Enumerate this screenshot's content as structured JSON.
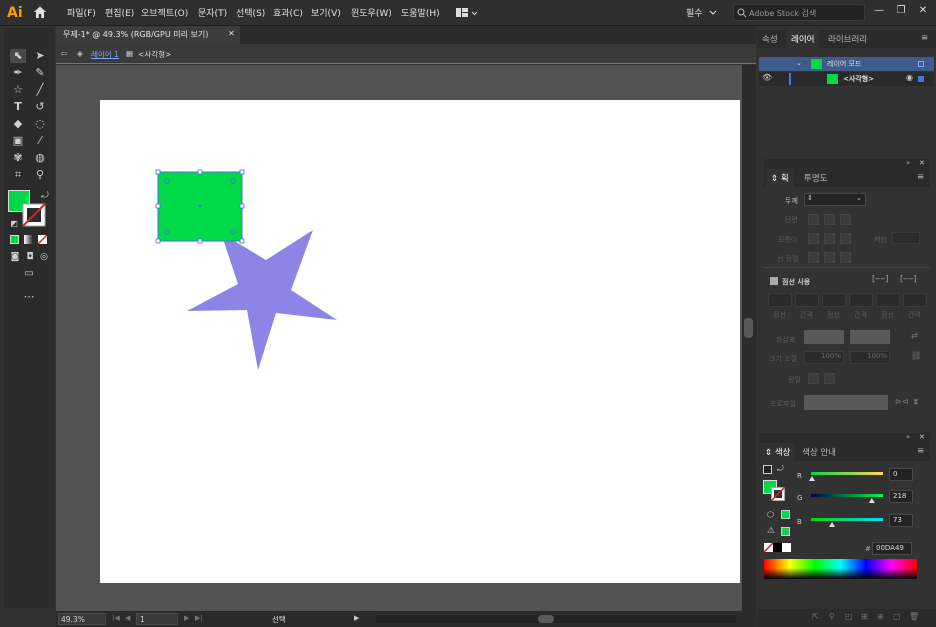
{
  "app": {
    "logo": "Ai",
    "menus": [
      "파일(F)",
      "편집(E)",
      "오브젝트(O)",
      "문자(T)",
      "선택(S)",
      "효과(C)",
      "보기(V)",
      "윈도우(W)",
      "도움말(H)"
    ],
    "workspace": "필수",
    "search_placeholder": "Adobe Stock 검색"
  },
  "document": {
    "tab_title": "무제-1* @ 49.3% (RGB/GPU 미리 보기)",
    "breadcrumb_layer": "레이어 1",
    "breadcrumb_object": "<사각형>"
  },
  "layers_panel": {
    "tabs": [
      "속성",
      "레이어",
      "라이브러리"
    ],
    "active_tab": "레이어",
    "rows": [
      {
        "name": "레이어 모드",
        "color": "#00DA49"
      },
      {
        "name": "<사각형>",
        "color": "#00DA49"
      }
    ]
  },
  "stroke_panel": {
    "tabs": [
      "획",
      "투명도"
    ],
    "weight_label": "두께",
    "cap_label": "단면",
    "corner_label": "모퉁이",
    "limit_label": "제한",
    "align_label": "선 정렬",
    "dashed_label": "점선 사용",
    "dash_labels": [
      "점선",
      "간격",
      "점선",
      "간격",
      "점선",
      "간격"
    ],
    "arrow_label": "화살표",
    "scale_label": "크기 조절",
    "scale_values": [
      "100%",
      "100%"
    ],
    "arrow_align_label": "정렬",
    "profile_label": "프로파일"
  },
  "color_panel": {
    "tabs": [
      "색상",
      "색상 안내"
    ],
    "channels": [
      {
        "label": "R",
        "value": "0",
        "fraction": 0.0
      },
      {
        "label": "G",
        "value": "218",
        "fraction": 0.855
      },
      {
        "label": "B",
        "value": "73",
        "fraction": 0.286
      }
    ],
    "hex_prefix": "#",
    "hex": "00DA49"
  },
  "status": {
    "zoom": "49.3%",
    "page": "1",
    "tool": "선택"
  },
  "colors": {
    "fill": "#00DA49",
    "star": "#8c85e6",
    "selection": "#4a6fd6",
    "accent_orange": "#ff9a00"
  }
}
